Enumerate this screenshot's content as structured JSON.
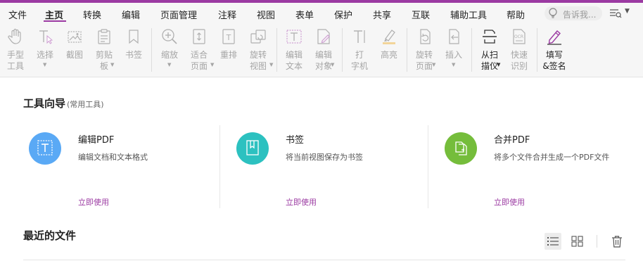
{
  "colors": {
    "accent": "#9b3aa2",
    "link": "#9b3aa2",
    "edit_icon_bg": "#5aa9f5",
    "bookmark_icon_bg": "#2cc1c0",
    "merge_icon_bg": "#75bd3b"
  },
  "menu": {
    "items": [
      "文件",
      "主页",
      "转换",
      "编辑",
      "页面管理",
      "注释",
      "视图",
      "表单",
      "保护",
      "共享",
      "互联",
      "辅助工具",
      "帮助"
    ],
    "active": "主页",
    "search_placeholder": "告诉我..."
  },
  "ribbon": {
    "tools": [
      {
        "label": "手型\n工具",
        "icon": "hand-icon",
        "enabled": false
      },
      {
        "label": "选择",
        "icon": "select-cursor-icon",
        "enabled": false,
        "has_dropdown": true
      },
      {
        "label": "截图",
        "icon": "snapshot-icon",
        "enabled": false
      },
      {
        "label": "剪贴\n板",
        "icon": "clipboard-icon",
        "enabled": false,
        "has_dropdown": true
      },
      {
        "label": "书签",
        "icon": "bookmark-icon",
        "enabled": false
      },
      {
        "label": "缩放",
        "icon": "zoom-icon",
        "enabled": false,
        "has_dropdown": true
      },
      {
        "label": "适合\n页面",
        "icon": "fit-page-icon",
        "enabled": false,
        "has_dropdown": true
      },
      {
        "label": "重排",
        "icon": "reflow-icon",
        "enabled": false
      },
      {
        "label": "旋转\n视图",
        "icon": "rotate-view-icon",
        "enabled": false,
        "has_dropdown": true
      },
      {
        "label": "编辑\n文本",
        "icon": "edit-text-icon",
        "enabled": false
      },
      {
        "label": "编辑\n对象",
        "icon": "edit-object-icon",
        "enabled": false,
        "has_dropdown": true
      },
      {
        "label": "打\n字机",
        "icon": "typewriter-icon",
        "enabled": false
      },
      {
        "label": "高亮",
        "icon": "highlight-icon",
        "enabled": false
      },
      {
        "label": "旋转\n页面",
        "icon": "rotate-page-icon",
        "enabled": false,
        "has_dropdown": true
      },
      {
        "label": "插入",
        "icon": "insert-icon",
        "enabled": false,
        "has_dropdown": true
      },
      {
        "label": "从扫\n描仪",
        "icon": "scanner-icon",
        "enabled": true,
        "has_dropdown": true
      },
      {
        "label": "快速\n识别",
        "icon": "ocr-icon",
        "enabled": false
      },
      {
        "label": "填写\n&签名",
        "icon": "fill-sign-icon",
        "enabled": true
      }
    ]
  },
  "tool_guide": {
    "title": "工具向导",
    "subtitle": "(常用工具)",
    "cards": [
      {
        "title": "编辑PDF",
        "desc": "编辑文档和文本格式",
        "link": "立即使用",
        "icon": "edit-pdf-icon"
      },
      {
        "title": "书签",
        "desc": "将当前视图保存为书签",
        "link": "立即使用",
        "icon": "bookmark-icon"
      },
      {
        "title": "合并PDF",
        "desc": "将多个文件合并生成一个PDF文件",
        "link": "立即使用",
        "icon": "merge-pdf-icon"
      }
    ]
  },
  "recent": {
    "title": "最近的文件"
  }
}
